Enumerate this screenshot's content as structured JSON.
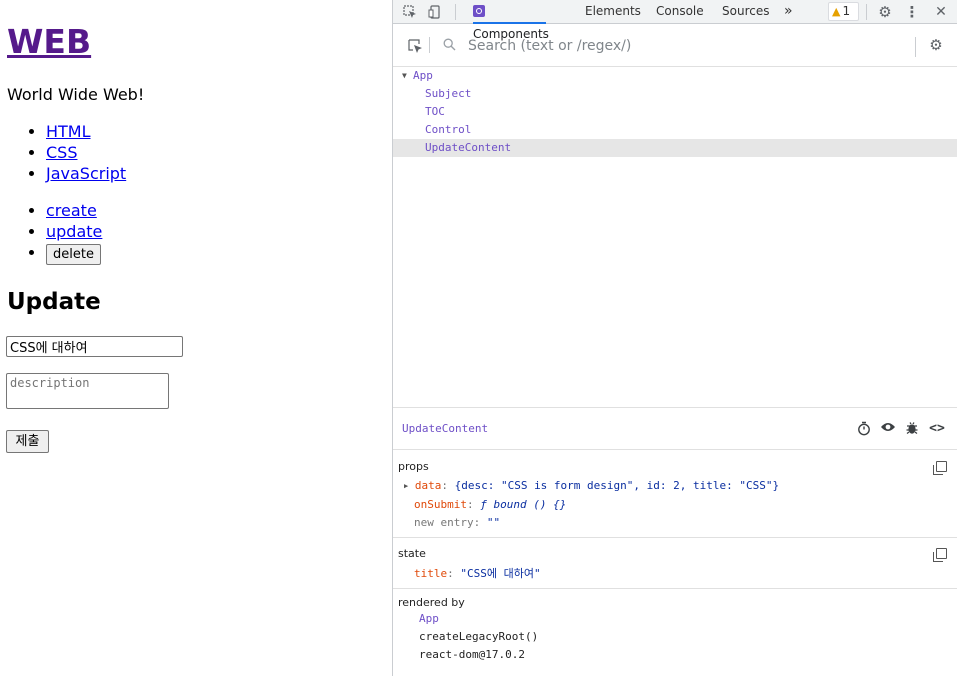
{
  "page": {
    "heading": "WEB",
    "intro": "World Wide Web!",
    "toc": [
      "HTML",
      "CSS",
      "JavaScript"
    ],
    "control": {
      "create": "create",
      "update": "update",
      "delete": "delete"
    },
    "form_heading": "Update",
    "title_value": "CSS에 대하여",
    "description_placeholder": "description",
    "submit_label": "제출"
  },
  "devtools": {
    "tabs": [
      "Components",
      "Elements",
      "Console",
      "Sources"
    ],
    "more_tabs": "»",
    "warning_count": "1",
    "search_placeholder": "Search (text or /regex/)",
    "tree": [
      {
        "label": "App",
        "expanded": true
      },
      {
        "label": "Subject"
      },
      {
        "label": "TOC"
      },
      {
        "label": "Control"
      },
      {
        "label": "UpdateContent",
        "selected": true
      }
    ],
    "selected_component": "UpdateContent",
    "props": {
      "title": "props",
      "data_key": "data",
      "data_value": "{desc: \"CSS is form design\", id: 2, title: \"CSS\"}",
      "onsubmit_key": "onSubmit",
      "onsubmit_value": "ƒ bound () {}",
      "new_entry_label": "new entry",
      "new_entry_value": "\"\""
    },
    "state": {
      "title": "state",
      "title_key": "title",
      "title_value": "\"CSS에 대하여\""
    },
    "rendered_by": {
      "title": "rendered by",
      "items": [
        "App",
        "createLegacyRoot()",
        "react-dom@17.0.2"
      ]
    }
  },
  "colors": {
    "accent": "#1a73e8",
    "react_purple": "#6e4fc7",
    "link": "#0000ee",
    "visited": "#551a8b"
  }
}
